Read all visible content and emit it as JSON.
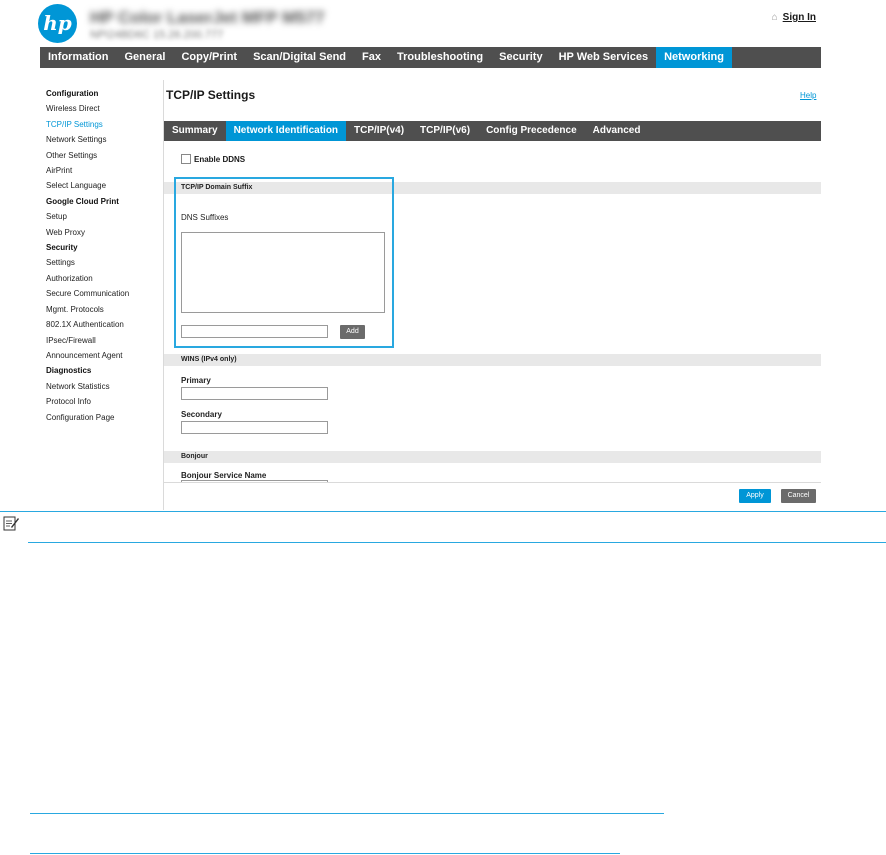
{
  "header": {
    "logo_text": "hp",
    "printer_name": "HP Color LaserJet MFP M577",
    "printer_subtitle": "NPI24BD6C  15.26.200.777",
    "signin_label": "Sign In"
  },
  "topnav": [
    "Information",
    "General",
    "Copy/Print",
    "Scan/Digital Send",
    "Fax",
    "Troubleshooting",
    "Security",
    "HP Web Services",
    "Networking"
  ],
  "sidebar": [
    {
      "label": "Configuration",
      "heading": true
    },
    {
      "label": "Wireless Direct"
    },
    {
      "label": "TCP/IP Settings",
      "active": true
    },
    {
      "label": "Network Settings"
    },
    {
      "label": "Other Settings"
    },
    {
      "label": "AirPrint"
    },
    {
      "label": "Select Language"
    },
    {
      "label": "Google Cloud Print",
      "heading": true
    },
    {
      "label": "Setup"
    },
    {
      "label": "Web Proxy"
    },
    {
      "label": "Security",
      "heading": true
    },
    {
      "label": "Settings"
    },
    {
      "label": "Authorization"
    },
    {
      "label": "Secure Communication"
    },
    {
      "label": "Mgmt. Protocols"
    },
    {
      "label": "802.1X Authentication"
    },
    {
      "label": "IPsec/Firewall"
    },
    {
      "label": "Announcement Agent"
    },
    {
      "label": "Diagnostics",
      "heading": true
    },
    {
      "label": "Network Statistics"
    },
    {
      "label": "Protocol Info"
    },
    {
      "label": "Configuration Page"
    }
  ],
  "main": {
    "title": "TCP/IP Settings",
    "help_label": "Help",
    "subtabs": [
      "Summary",
      "Network Identification",
      "TCP/IP(v4)",
      "TCP/IP(v6)",
      "Config Precedence",
      "Advanced"
    ],
    "active_subtab": "Network Identification",
    "enable_ddns_label": "Enable DDNS",
    "domain_suffix_header": "TCP/IP Domain Suffix",
    "dns_suffixes_label": "DNS Suffixes",
    "add_label": "Add",
    "wins_header": "WINS (IPv4 only)",
    "primary_label": "Primary",
    "secondary_label": "Secondary",
    "bonjour_header": "Bonjour",
    "bonjour_service_label": "Bonjour Service Name",
    "apply_label": "Apply",
    "cancel_label": "Cancel"
  },
  "colors": {
    "accent": "#0096d6",
    "nav_bg": "#4f4f4f",
    "highlight": "#29a8e0"
  }
}
